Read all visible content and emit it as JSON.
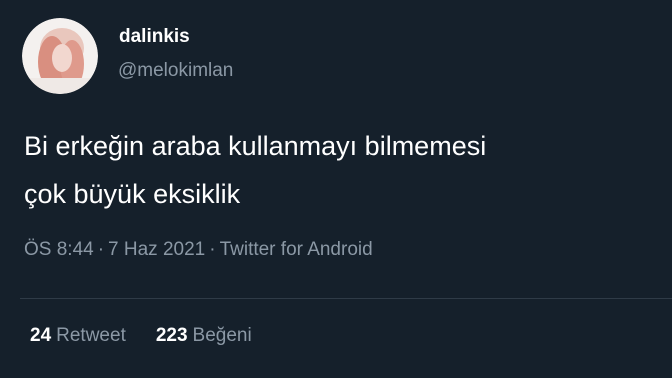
{
  "user": {
    "display_name": "dalinkis",
    "handle": "@melokimlan"
  },
  "tweet": {
    "text_line_1": "Bi erkeğin araba kullanmayı bilmemesi",
    "text_line_2": "çok büyük eksiklik"
  },
  "meta": {
    "time": "ÖS 8:44",
    "separator": "·",
    "date": "7 Haz 2021",
    "source": "Twitter for Android"
  },
  "stats": {
    "retweet_count": "24",
    "retweet_label": "Retweet",
    "like_count": "223",
    "like_label": "Beğeni"
  },
  "colors": {
    "background": "#15202b",
    "primary_text": "#ffffff",
    "secondary_text": "#8b98a5",
    "divider": "#2f3b47"
  }
}
